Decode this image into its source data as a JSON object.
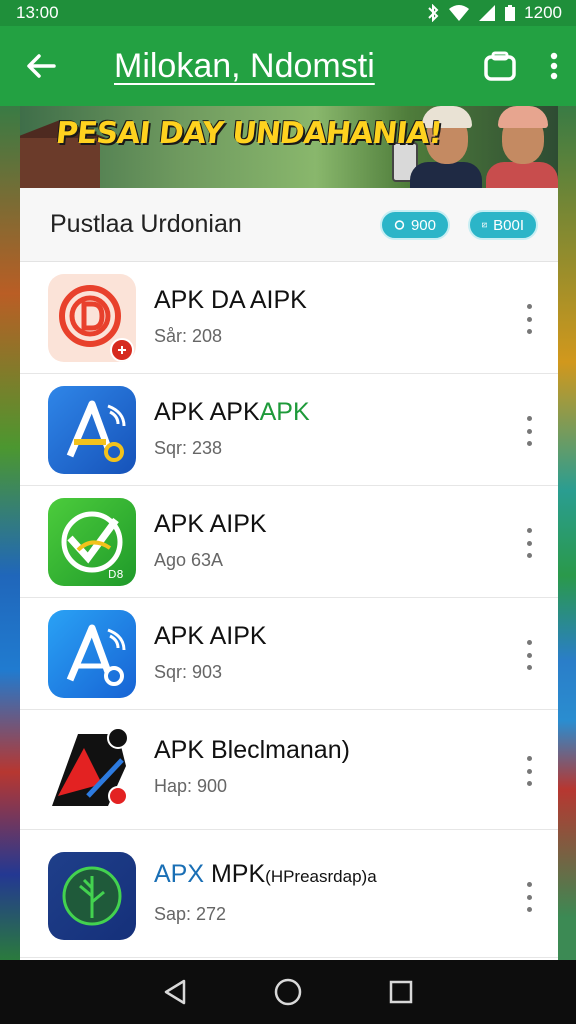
{
  "status_bar": {
    "time": "13:00",
    "clock_right": "1200"
  },
  "app_bar": {
    "title": "Milokan, Ndomsti"
  },
  "banner": {
    "headline": "PESAI DAY UNDAHANIA!"
  },
  "section": {
    "title": "Pustlaa Urdonian",
    "chip_1": "900",
    "chip_2": "B00I"
  },
  "apps": [
    {
      "name": "APK DA AIPK",
      "meta": "Sår: 208",
      "icon": "target-d-app-icon"
    },
    {
      "name_part1": "APK APK",
      "name_part2": "APK",
      "meta": "Sqr: 238",
      "icon": "blue-a-app-icon"
    },
    {
      "name": "APK AIPK",
      "meta": "Ago 63A",
      "icon": "green-check-app-icon"
    },
    {
      "name": "APK AIPK",
      "meta": "Sqr: 903",
      "icon": "blue-a-light-app-icon"
    },
    {
      "name": "APK Bleclmanan)",
      "meta": "Hap: 900",
      "icon": "red-black-a-app-icon"
    },
    {
      "name_part1": "APX",
      "name_part2": " MPK",
      "name_part3": "(HPreasrdap)a",
      "meta": "Sap: 272",
      "icon": "tree-circle-app-icon"
    }
  ],
  "colors": {
    "status_bar": "#1f8f3a",
    "app_bar": "#23a142",
    "chip": "#2bb5c8"
  }
}
